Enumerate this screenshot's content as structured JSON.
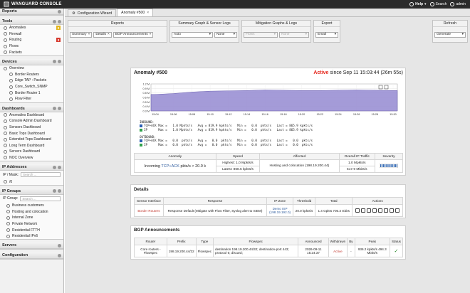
{
  "topbar": {
    "brand": "WANGUARD CONSOLE",
    "help": "Help",
    "search": "Search",
    "user": "admin"
  },
  "sidebar": {
    "reports": {
      "title": "Reports"
    },
    "tools": {
      "title": "Tools",
      "items": [
        {
          "label": "Anomalies",
          "badge": "0",
          "badge_color": "#e3b51c"
        },
        {
          "label": "Firewall",
          "badge": "",
          "badge_color": ""
        },
        {
          "label": "Routing",
          "badge": "3",
          "badge_color": "#d6392e"
        },
        {
          "label": "Flows",
          "badge": "",
          "badge_color": ""
        },
        {
          "label": "Packets",
          "badge": "",
          "badge_color": ""
        }
      ]
    },
    "devices": {
      "title": "Devices",
      "overview": "Overview",
      "items": [
        "Border Routers",
        "Edge TAP : Packets",
        "Core_Switch_SNMP",
        "Border Router 1",
        "Flow Filter"
      ]
    },
    "dashboards": {
      "title": "Dashboards",
      "items": [
        "Anomalies Dashboard",
        "Console Admin Dashboard",
        "Sensors Dashboard",
        "Basic Tops Dashboard",
        "Extended Tops Dashboard",
        "Long Term Dashboard",
        "Servers Dashboard",
        "NOC Overview"
      ]
    },
    "ip_addresses": {
      "title": "IP Addresses",
      "mask_label": "IP / Mask:",
      "placeholder": "Search ...",
      "tree": "/0"
    },
    "ip_groups": {
      "title": "IP Groups",
      "group_label": "IP Group:",
      "placeholder": "Search ...",
      "items": [
        "Business customers",
        "Hosting and colocation",
        "Internal Zone",
        "Private Network",
        "Residential FTTH",
        "Residential IPv6"
      ]
    },
    "servers": {
      "title": "Servers"
    },
    "configuration": {
      "title": "Configuration"
    }
  },
  "tabs": [
    {
      "label": "Configuration Wizard"
    },
    {
      "label": "Anomaly #500"
    }
  ],
  "filters": {
    "reports": {
      "label": "Reports",
      "chips": [
        "Summary",
        "Details",
        "BGP Announcements"
      ]
    },
    "graphs": {
      "label": "Summary Graph & Sensor Logs",
      "sel1": "Auto",
      "sel2": "None"
    },
    "mitigation": {
      "label": "Mitigation Graphs & Logs",
      "sel1": "Flows",
      "sel2": "None"
    },
    "export": {
      "label": "Export",
      "sel": "Email"
    },
    "refresh": {
      "label": "Refresh",
      "sel": "Generate"
    }
  },
  "anomaly": {
    "title": "Anomaly #500",
    "status": "Active",
    "since": "since Sep 11 15:03:44 (26m 55s)"
  },
  "chart_data": {
    "type": "area",
    "title": "",
    "xlabel": "",
    "ylabel": "",
    "x": [
      "15:04",
      "15:06",
      "15:08",
      "15:10",
      "15:12",
      "15:14",
      "15:16",
      "15:18",
      "15:20",
      "15:22",
      "15:24",
      "15:26",
      "15:28",
      "15:30"
    ],
    "yticks": [
      "0.3 M",
      "0.4 M",
      "0.5 M",
      "0.6 M",
      "0.8 M",
      "0.9 M",
      "1.2 M"
    ],
    "ylim": [
      0.3,
      1.2
    ],
    "series": [
      {
        "name": "",
        "color": "#9b91d4",
        "values": [
          0.85,
          0.88,
          0.93,
          0.96,
          0.97,
          0.98,
          1.0,
          0.99,
          0.98,
          0.98,
          0.99,
          1.0,
          0.99,
          0.98
        ]
      }
    ]
  },
  "rates": {
    "inbound_title": "INBOUND:",
    "inbound": [
      {
        "name": "TCP+ACK",
        "color": "#2b5fb3",
        "text": " Max =   1.0 Mpkts/s   Avg = 819.9 kpkts/s   Min =   0.0  pkts/s   Last = 865.9 kpkts/s"
      },
      {
        "name": "IP",
        "color": "#2fa24a",
        "text": "      Max =   1.0 Mpkts/s   Avg = 819.9 kpkts/s   Min =   0.0  pkts/s   Last = 865.9 kpkts/s"
      }
    ],
    "outbound_title": "OUTBOUND:",
    "outbound": [
      {
        "name": "TCP+ACK",
        "color": "#2b5fb3",
        "text": " Max =   0.0  pkts/s   Avg =   0.0  pkts/s   Min =   0.0  pkts/s   Last =   0.0  pkts/s"
      },
      {
        "name": "IP",
        "color": "#2fa24a",
        "text": "      Max =   0.0  pkts/s   Avg =   0.0  pkts/s   Min =   0.0  pkts/s   Last =   0.0  pkts/s"
      }
    ]
  },
  "summary": {
    "headers": [
      "Anomaly",
      "Speed",
      "Affected",
      "Overall IP Traffic",
      "Severity"
    ],
    "anomaly_pre": "Incoming ",
    "anomaly_link": "TCP+ACK",
    "anomaly_post": " pkts/s > 20.0 k",
    "speed_high": "Highest: 1.0 Mpkts/s",
    "speed_latest": "Latest: 868.5 kpkts/s",
    "affected": "Hosting and colocation (198.19.200.44)",
    "overall_1": "1.0 Mpkts/s",
    "overall_2": "517.9 Mbits/s"
  },
  "details": {
    "title": "Details",
    "headers": [
      "Sensor Interface",
      "Response",
      "IP Zone",
      "Threshold",
      "Total",
      "Actions"
    ],
    "row": {
      "sensor": "Border Routers",
      "response": "Response Default (Mitigate with Flow Filter, Syslog alert to SIEM)",
      "zone": "Demo ISP",
      "zone_ip": "(198.19.192.0)",
      "threshold": "20.0 kpkts/s",
      "total": "1.4 Gpkts 705.3 Gbits"
    }
  },
  "bgp": {
    "title": "BGP Announcements",
    "headers": [
      "Router",
      "Prefix",
      "Type",
      "Flowspec",
      "Announced",
      "Withdrawn",
      "By",
      "Peak",
      "Status"
    ],
    "row": {
      "router": "Core routers - Flowspec",
      "prefix": "198.19.200.44/32",
      "type": "Flowspec",
      "flowspec": "destination 198.19.200.44/32; destination-port 443; protocol 6; discard;",
      "announced": "2026-09-11 15:24:37",
      "withdrawn": "Active",
      "by": "-",
      "peak": "936.2 kpkts/s 494.3 Mbits/s"
    }
  }
}
